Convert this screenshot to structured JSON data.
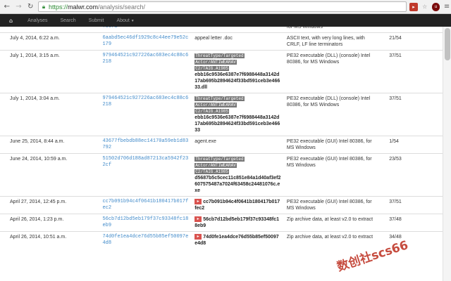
{
  "browser": {
    "url_scheme": "https://",
    "url_host": "malwr.com",
    "url_path": "/analysis/search/",
    "back_icon": "arrow-left-icon",
    "forward_icon": "arrow-right-icon",
    "reload_icon": "reload-icon",
    "lock_icon": "lock-icon"
  },
  "navbar": {
    "home_icon": "home-icon",
    "items": [
      "Analyses",
      "Search",
      "Submit",
      "About"
    ]
  },
  "rows": [
    {
      "date": "",
      "md5": "fc6fa",
      "tags": [],
      "name": "",
      "type": "for MS Windows",
      "score": ""
    },
    {
      "date": "July 4, 2014, 6:22 a.m.",
      "md5": "6aabd5ec46df1929c8c44ee79e52c179",
      "tags": [],
      "name": "appeal letter .doc",
      "type": "ASCII text, with very long lines, with CRLF, LF line terminators",
      "score": "21/54"
    },
    {
      "date": "July 1, 2014, 3:15 a.m.",
      "md5": "979464521c927226ac683ec4c88c6218",
      "tags": [
        "ThreatType/Targeted",
        "Actor/ANTIWEARAV",
        "C2/TAIG.A1985"
      ],
      "name": "ebb16c9536e6387e7f6988448a3142d17ab695b2894624f33bd591ceb3e46633",
      "name_ext": ".dll",
      "type": "PE32 executable (DLL) (console) Intel 80386, for MS Windows",
      "score": "37/51"
    },
    {
      "date": "July 1, 2014, 3:04 a.m.",
      "md5": "979464521c927226ac683ec4c88c6218",
      "tags": [
        "ThreatType/Targeted",
        "Actor/ANTIWEARAV",
        "C2/TAIG.A1985"
      ],
      "name": "ebb16c9536e6387e7f6988448a3142d17ab695b2894624f33bd591ceb3e46633",
      "name_ext": "",
      "type": "PE32 executable (DLL) (console) Intel 80386, for MS Windows",
      "score": "37/51"
    },
    {
      "date": "June 25, 2014, 8:44 a.m.",
      "md5": "43677fbebdb88ec14170a59eb1d83792",
      "tags": [],
      "name": "agent.exe",
      "type": "PE32 executable (GUI) Intel 80386, for MS Windows",
      "score": "1/54"
    },
    {
      "date": "June 24, 2014, 10:59 a.m.",
      "md5": "51502d706d188ad87213ca5942f232cf",
      "tags": [
        "ThreatType/Targeted",
        "Actor/ANTIWEARAV",
        "C2/TAIG.A1985"
      ],
      "name": "d5687b5c5cec11c851e84a1d40af3ef2607575487a7024f63458c2448",
      "name_ext": "1076c.exe",
      "type": "PE32 executable (GUI) Intel 80386, for MS Windows",
      "score": "23/53"
    },
    {
      "date": "April 27, 2014, 12:45 p.m.",
      "md5": "cc7b091b94c4f0641b180417b017fec2",
      "tags": [],
      "flag": true,
      "name": "cc7b091b94c4f0641b180417b017fec2",
      "name_ext": "",
      "type": "PE32 executable (GUI) Intel 80386, for MS Windows",
      "score": "37/51"
    },
    {
      "date": "April 26, 2014, 1:23 p.m.",
      "md5": "56cb7d12bd5eb179f37c93348fc18eb9",
      "tags": [],
      "flag": true,
      "name": "56cb7d12bd5eb179f37c93348fc18eb9",
      "name_ext": "",
      "type": "Zip archive data, at least v2.0 to extract",
      "score": "37/48"
    },
    {
      "date": "April 26, 2014, 10:51 a.m.",
      "md5": "74d0fe1ea4dce76d55b85ef50097e4d8",
      "tags": [],
      "flag": true,
      "name": "74d0fe1ea4dce76d55b85ef50097e4d8",
      "name_ext": "",
      "type": "Zip archive data, at least v2.0 to extract",
      "score": "34/48"
    }
  ],
  "watermark": "数创社scs66"
}
